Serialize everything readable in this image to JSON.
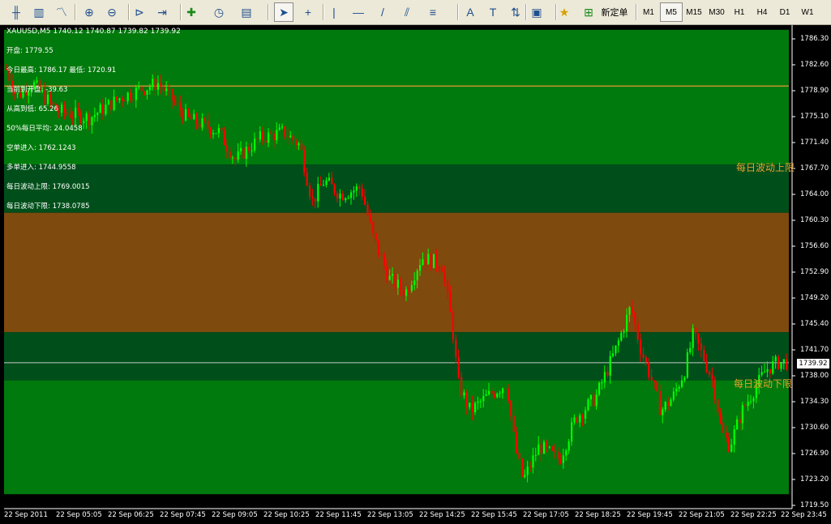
{
  "toolbar": {
    "buttons": [
      {
        "icon": "bar-chart-icon"
      },
      {
        "icon": "candlestick-icon"
      },
      {
        "icon": "line-chart-icon"
      },
      {
        "icon": "zoom-in-icon"
      },
      {
        "icon": "zoom-out-icon"
      },
      {
        "icon": "chart-shift-icon"
      },
      {
        "icon": "autoscroll-icon"
      },
      {
        "icon": "indicators-icon"
      },
      {
        "icon": "periods-icon"
      },
      {
        "icon": "templates-icon"
      },
      {
        "icon": "cursor-icon"
      },
      {
        "icon": "crosshair-icon"
      },
      {
        "icon": "vertical-line-icon"
      },
      {
        "icon": "horizontal-line-icon"
      },
      {
        "icon": "trendline-icon"
      },
      {
        "icon": "equidistant-channel-icon"
      },
      {
        "icon": "fibonacci-icon"
      },
      {
        "icon": "text-icon"
      },
      {
        "icon": "text-label-icon"
      },
      {
        "icon": "arrows-icon"
      },
      {
        "icon": "navigator-icon"
      },
      {
        "icon": "favorites-icon"
      },
      {
        "icon": "new-order-icon"
      }
    ],
    "new_order_label": "新定单",
    "timeframes": [
      "M1",
      "M5",
      "M15",
      "M30",
      "H1",
      "H4",
      "D1",
      "W1"
    ],
    "active_timeframe": "M5"
  },
  "chart": {
    "symbol_line": "XAUUSD,M5  1740.12 1740.87 1739.82 1739.92",
    "current_price": "1739.92",
    "overlay_lines": [
      "开盘: 1779.55",
      "今日最高: 1786.17  最低: 1720.91",
      "当前到开盘: -39.63",
      "从高到低: 65.26",
      "50%每日平均: 24.0458",
      "空单进入: 1762.1243",
      "多单进入: 1744.9558",
      "每日波动上限: 1769.0015",
      "每日波动下限: 1738.0785"
    ],
    "band_upper_label": "每日波动上限",
    "band_lower_label": "每日波动下限",
    "y_ticks": [
      "1786.30",
      "1782.60",
      "1778.90",
      "1775.10",
      "1771.40",
      "1767.70",
      "1764.00",
      "1760.30",
      "1756.60",
      "1752.90",
      "1749.20",
      "1745.40",
      "1741.70",
      "1738.00",
      "1734.30",
      "1730.60",
      "1726.90",
      "1723.20",
      "1719.50"
    ],
    "x_ticks": [
      "22 Sep 2011",
      "22 Sep 05:05",
      "22 Sep 06:25",
      "22 Sep 07:45",
      "22 Sep 09:05",
      "22 Sep 10:25",
      "22 Sep 11:45",
      "22 Sep 13:05",
      "22 Sep 14:25",
      "22 Sep 15:45",
      "22 Sep 17:05",
      "22 Sep 18:25",
      "22 Sep 19:45",
      "22 Sep 21:05",
      "22 Sep 22:25",
      "22 Sep 23:45"
    ],
    "colors": {
      "bull": "#00ff00",
      "bear": "#ff0000",
      "band_dark": "#004f1a",
      "band_orange": "#7e4a0e",
      "bg_green": "#007a0c",
      "open_line": "#ff9a3c"
    }
  }
}
